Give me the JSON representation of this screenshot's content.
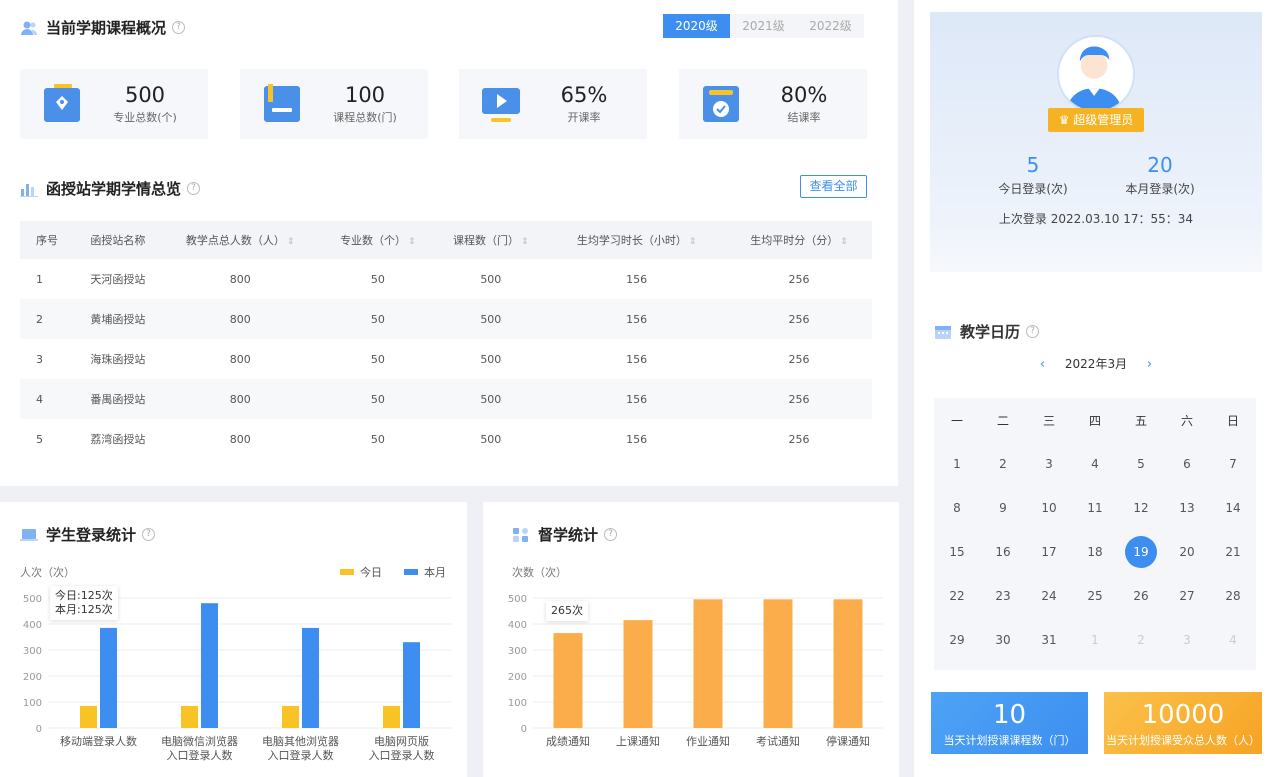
{
  "overview": {
    "title": "当前学期课程概况",
    "tabs": [
      {
        "label": "2020级",
        "active": true
      },
      {
        "label": "2021级",
        "active": false
      },
      {
        "label": "2022级",
        "active": false
      }
    ],
    "stats": [
      {
        "value": "500",
        "label": "专业总数(个)",
        "icon": "major-icon"
      },
      {
        "value": "100",
        "label": "课程总数(门)",
        "icon": "course-icon"
      },
      {
        "value": "65%",
        "label": "开课率",
        "icon": "play-icon"
      },
      {
        "value": "80%",
        "label": "结课率",
        "icon": "check-icon"
      }
    ]
  },
  "station": {
    "title": "函授站学期学情总览",
    "view_all": "查看全部",
    "columns": [
      "序号",
      "函授站名称",
      "教学点总人数（人）",
      "专业数（个）",
      "课程数（门）",
      "生均学习时长（小时）",
      "生均平时分（分）"
    ],
    "sortable": [
      false,
      false,
      true,
      true,
      true,
      true,
      true
    ],
    "rows": [
      [
        "1",
        "天河函授站",
        "800",
        "50",
        "500",
        "156",
        "256"
      ],
      [
        "2",
        "黄埔函授站",
        "800",
        "50",
        "500",
        "156",
        "256"
      ],
      [
        "3",
        "海珠函授站",
        "800",
        "50",
        "500",
        "156",
        "256"
      ],
      [
        "4",
        "番禺函授站",
        "800",
        "50",
        "500",
        "156",
        "256"
      ],
      [
        "5",
        "荔湾函授站",
        "800",
        "50",
        "500",
        "156",
        "256"
      ]
    ]
  },
  "login_chart_panel": {
    "title": "学生登录统计",
    "ylabel": "人次（次）",
    "legend": [
      "今日",
      "本月"
    ],
    "tooltip_line1": "今日:125次",
    "tooltip_line2": "本月:125次"
  },
  "supervise_chart_panel": {
    "title": "督学统计",
    "ylabel": "次数（次）",
    "tooltip": "265次"
  },
  "colors": {
    "accent": "#3d8ef0",
    "yellow": "#f7c325",
    "orange": "#fbad4c"
  },
  "chart_data": [
    {
      "type": "bar",
      "title": "学生登录统计",
      "ylabel": "人次（次）",
      "categories": [
        [
          "移动端登录人数"
        ],
        [
          "电脑微信浏览器",
          "入口登录人数"
        ],
        [
          "电脑其他浏览器",
          "入口登录人数"
        ],
        [
          "电脑网页版",
          "入口登录人数"
        ]
      ],
      "series": [
        {
          "name": "今日",
          "color": "#f7c325",
          "values": [
            85,
            85,
            85,
            85
          ]
        },
        {
          "name": "本月",
          "color": "#3d8ef0",
          "values": [
            385,
            480,
            385,
            330
          ]
        }
      ],
      "ylim": [
        0,
        500
      ],
      "yticks": [
        0,
        100,
        200,
        300,
        400,
        500
      ],
      "legend_position": "top-right",
      "grid": true
    },
    {
      "type": "bar",
      "title": "督学统计",
      "ylabel": "次数（次）",
      "categories": [
        [
          "成绩通知"
        ],
        [
          "上课通知"
        ],
        [
          "作业通知"
        ],
        [
          "考试通知"
        ],
        [
          "停课通知"
        ]
      ],
      "series": [
        {
          "name": "",
          "color": "#fbad4c",
          "values": [
            365,
            415,
            495,
            495,
            495
          ]
        }
      ],
      "ylim": [
        0,
        500
      ],
      "yticks": [
        0,
        100,
        200,
        300,
        400,
        500
      ],
      "grid": true
    }
  ],
  "profile": {
    "badge": "超级管理员",
    "today_login": "5",
    "today_login_label": "今日登录(次)",
    "month_login": "20",
    "month_login_label": "本月登录(次)",
    "last_login": "上次登录 2022.03.10 17：55：34"
  },
  "calendar": {
    "title": "教学日历",
    "month": "2022年3月",
    "weekdays": [
      "一",
      "二",
      "三",
      "四",
      "五",
      "六",
      "日"
    ],
    "weeks": [
      [
        [
          "1",
          0
        ],
        [
          "2",
          0
        ],
        [
          "3",
          0
        ],
        [
          "4",
          0
        ],
        [
          "5",
          0
        ],
        [
          "6",
          0
        ],
        [
          "7",
          0
        ]
      ],
      [
        [
          "8",
          0
        ],
        [
          "9",
          0
        ],
        [
          "10",
          0
        ],
        [
          "11",
          0
        ],
        [
          "12",
          0
        ],
        [
          "13",
          0
        ],
        [
          "14",
          0
        ]
      ],
      [
        [
          "15",
          0
        ],
        [
          "16",
          0
        ],
        [
          "17",
          0
        ],
        [
          "18",
          0
        ],
        [
          "19",
          2
        ],
        [
          "20",
          0
        ],
        [
          "21",
          0
        ]
      ],
      [
        [
          "22",
          0
        ],
        [
          "23",
          0
        ],
        [
          "24",
          0
        ],
        [
          "25",
          0
        ],
        [
          "26",
          0
        ],
        [
          "27",
          0
        ],
        [
          "28",
          0
        ]
      ],
      [
        [
          "29",
          0
        ],
        [
          "30",
          0
        ],
        [
          "31",
          0
        ],
        [
          "1",
          1
        ],
        [
          "2",
          1
        ],
        [
          "3",
          1
        ],
        [
          "4",
          1
        ]
      ]
    ]
  },
  "bottom": {
    "planned_courses": "10",
    "planned_courses_label": "当天计划授课课程数（门）",
    "planned_students": "10000",
    "planned_students_label": "当天计划授课受众总人数（人）"
  }
}
